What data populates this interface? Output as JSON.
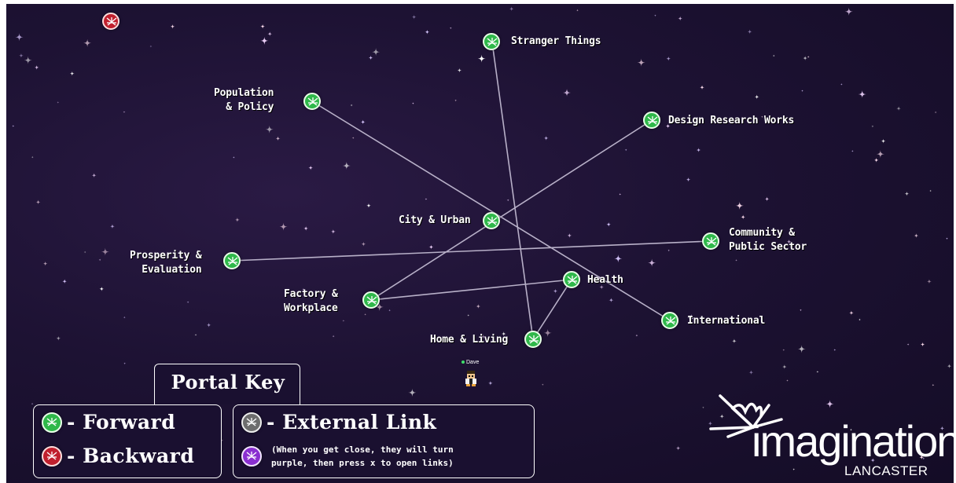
{
  "portals": [
    {
      "id": "stranger-things",
      "label": "Stranger Things",
      "color": "green"
    },
    {
      "id": "population-policy",
      "label": "Population\n& Policy",
      "color": "green"
    },
    {
      "id": "design-research-works",
      "label": "Design Research Works",
      "color": "green"
    },
    {
      "id": "city-urban",
      "label": "City & Urban",
      "color": "green"
    },
    {
      "id": "community-public-sector",
      "label": "Community &\nPublic Sector",
      "color": "green"
    },
    {
      "id": "prosperity-evaluation",
      "label": "Prosperity &\nEvaluation",
      "color": "green"
    },
    {
      "id": "health",
      "label": "Health",
      "color": "green"
    },
    {
      "id": "factory-workplace",
      "label": "Factory &\nWorkplace",
      "color": "green"
    },
    {
      "id": "international",
      "label": "International",
      "color": "green"
    },
    {
      "id": "home-living",
      "label": "Home & Living",
      "color": "green"
    },
    {
      "id": "back",
      "label": "",
      "color": "red"
    }
  ],
  "player": {
    "name": "Dave"
  },
  "portal_key": {
    "title": "Portal Key",
    "forward": "- Forward",
    "backward": "- Backward",
    "external": "- External Link",
    "note_line1": "(When you get close, they will turn",
    "note_line2": "purple, then press x to open links)"
  },
  "logo": {
    "word": "imagination",
    "sub": "LANCASTER"
  },
  "colors": {
    "background": "#1d1233",
    "forward": "#2fb84a",
    "backward": "#c0202e",
    "external": "#6d6d6d",
    "active": "#8a2fd0",
    "line": "#b8b0c8"
  }
}
